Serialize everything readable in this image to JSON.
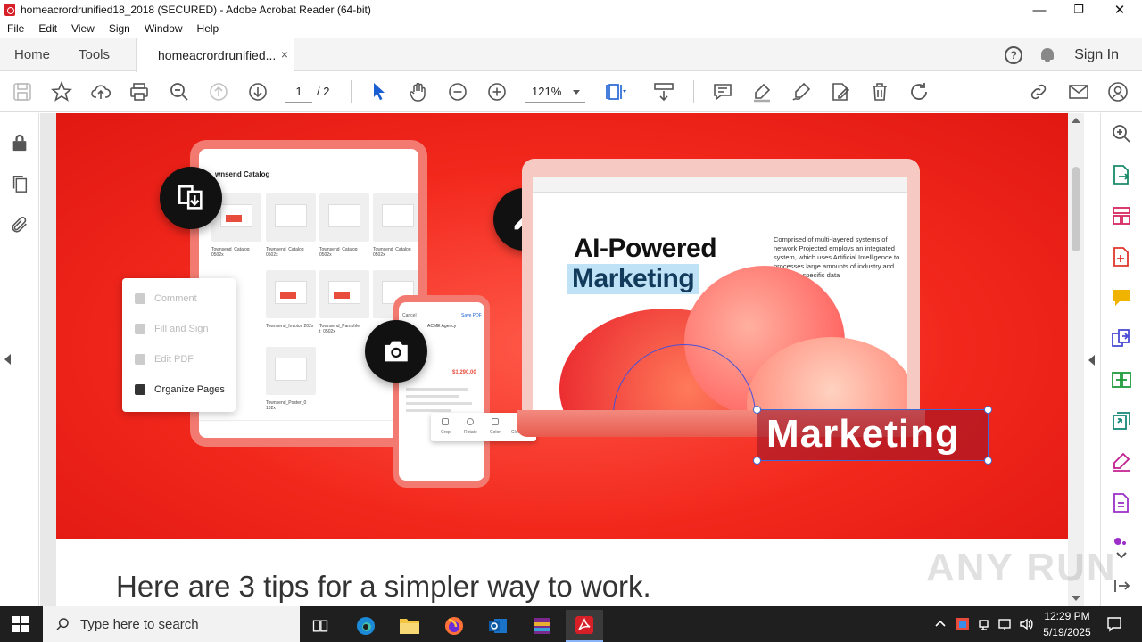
{
  "window": {
    "title": "homeacrordrunified18_2018 (SECURED) - Adobe Acrobat Reader (64-bit)",
    "min_glyph": "—",
    "max_glyph": "❐",
    "close_glyph": "✕"
  },
  "menu": [
    "File",
    "Edit",
    "View",
    "Sign",
    "Window",
    "Help"
  ],
  "tabs": {
    "home": "Home",
    "tools": "Tools",
    "document": "homeacrordrunified...",
    "close_glyph": "×"
  },
  "header": {
    "help_glyph": "?",
    "sign_in": "Sign In"
  },
  "toolbar": {
    "page_current": "1",
    "page_total": "/  2",
    "zoom": "121%"
  },
  "document": {
    "tips_heading": "Here are 3 tips for a simpler way to work.",
    "tablet": {
      "catalog_title": "wnsend Catalog",
      "thumb_captions": [
        "Townsend_Catalog_ 0502x",
        "Townsend_Catalog_ 0502x",
        "Townsend_Catalog_ 0502x",
        "Townsend_Catalog_ 0502x",
        "Townsend_Invoice 202x",
        "Townsend_Pamphle t_0502x",
        "Townsend_Poster_0 102x"
      ]
    },
    "context_menu": [
      "Comment",
      "Fill and Sign",
      "Edit PDF",
      "Organize Pages"
    ],
    "phone": {
      "top_left": "Cancel",
      "top_right": "Save PDF",
      "agency": "ACME Agency",
      "amount": "$1,290.00"
    },
    "edit_popup": [
      "Crop",
      "Rotate",
      "Color",
      "Cleanup"
    ],
    "laptop": {
      "headline_1": "AI-Powered",
      "headline_2": "Marketing",
      "paragraph": "Comprised of multi-layered systems of network Projected employs an integrated system, which uses Artificial Intelligence to processes large amounts of industry and company specific data"
    },
    "selected_text": "Marketing"
  },
  "watermark": "ANY RUN",
  "taskbar": {
    "search_placeholder": "Type here to search",
    "time": "12:29 PM",
    "date": "5/19/2025"
  },
  "colors": {
    "hero_red": "#f2271c",
    "acrobat_red": "#d61f26",
    "selection_blue": "#3b6bd6",
    "highlight_blue": "#bfe2f7"
  }
}
